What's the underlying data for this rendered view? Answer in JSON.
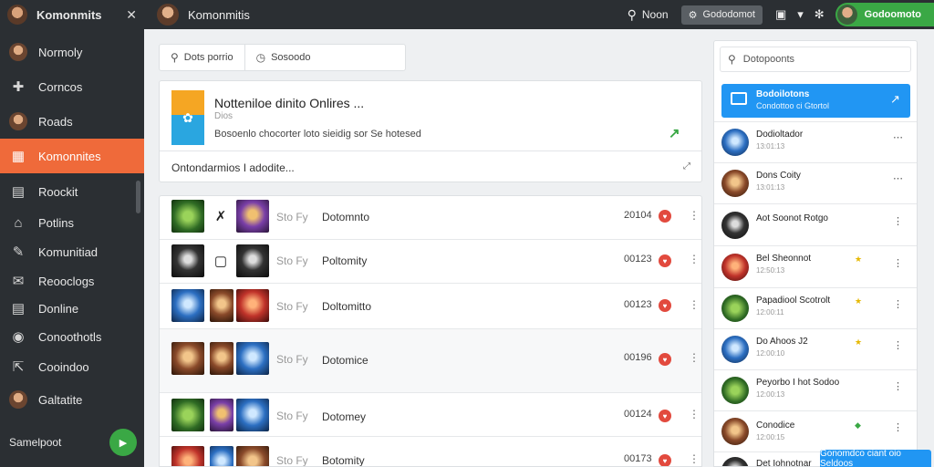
{
  "sidebar": {
    "title": "Komonmits",
    "items": [
      {
        "label": "Normoly",
        "icon": "user-avatar-icon",
        "active": false
      },
      {
        "label": "Corncos",
        "icon": "puzzle-icon",
        "active": false
      },
      {
        "label": "Roads",
        "icon": "user-avatar-icon",
        "active": false
      },
      {
        "label": "Komonnites",
        "icon": "community-icon",
        "active": true
      },
      {
        "label": "Roockit",
        "icon": "calendar-icon",
        "active": false
      },
      {
        "label": "Potlins",
        "icon": "building-icon",
        "active": false
      },
      {
        "label": "Komunitiad",
        "icon": "wrench-icon",
        "active": false
      },
      {
        "label": "Reooclogs",
        "icon": "mail-icon",
        "active": false
      },
      {
        "label": "Donline",
        "icon": "calendar-icon",
        "active": false
      },
      {
        "label": "Conoothotls",
        "icon": "chat-icon",
        "active": false
      },
      {
        "label": "Cooindoo",
        "icon": "share-icon",
        "active": false
      },
      {
        "label": "Galtatite",
        "icon": "user-avatar-icon",
        "active": false
      }
    ],
    "footer_label": "Samelpoot"
  },
  "topbar": {
    "title": "Komonmitis",
    "search_label": "Noon",
    "button_label": "Gododomot",
    "user_label": "Godoomoto"
  },
  "tabs": [
    {
      "label": "Dots porrio",
      "icon": "search-icon"
    },
    {
      "label": "Sosoodo",
      "icon": "clock-icon"
    }
  ],
  "hero": {
    "title": "Notteniloe dinito Onlires ...",
    "subtitle": "Dios",
    "description": "Bosoenlo chocorter loto sieidig sor Se hotesed",
    "input_placeholder": "Ontondarmios I adodite..."
  },
  "list": {
    "rows": [
      {
        "code": "Sto Fy",
        "name": "Dotomnto",
        "count": "20104"
      },
      {
        "code": "Sto Fy",
        "name": "Poltomity",
        "count": "00123"
      },
      {
        "code": "Sto Fy",
        "name": "Doltomitto",
        "count": "00123"
      },
      {
        "code": "Sto Fy",
        "name": "Dotomice",
        "count": "00196"
      },
      {
        "code": "Sto Fy",
        "name": "Dotomey",
        "count": "00124"
      },
      {
        "code": "Sto Fy",
        "name": "Botomity",
        "count": "00173"
      }
    ]
  },
  "rightpanel": {
    "search_placeholder": "Dotopoonts",
    "feature": {
      "title": "Bodoilotons",
      "subtitle": "Condottoo ci Gtortol"
    },
    "items": [
      {
        "name": "Dodioltador",
        "sub": "13:01:13",
        "badge": ""
      },
      {
        "name": "Dons Coity",
        "sub": "13:01:13",
        "badge": ""
      },
      {
        "name": "Aot Soonot Rotgo",
        "sub": "",
        "badge": ""
      },
      {
        "name": "Bel Sheonnot",
        "sub": "12:50:13",
        "badge": "star-yellow"
      },
      {
        "name": "Papadiool Scotrolt",
        "sub": "12:00:11",
        "badge": "star-yellow"
      },
      {
        "name": "Do Ahoos J2",
        "sub": "12:00:10",
        "badge": "star-yellow"
      },
      {
        "name": "Peyorbo I hot Sodoo",
        "sub": "12:00:13",
        "badge": ""
      },
      {
        "name": "Conodice",
        "sub": "12:00:15",
        "badge": "star-green"
      },
      {
        "name": "Det Iohnotnar",
        "sub": "",
        "badge": ""
      }
    ]
  },
  "toast": {
    "label": "Gonomdco ciant oio Seldoos"
  },
  "colors": {
    "accent": "#ef6a3a",
    "primary": "#2196f3",
    "success": "#3aa845",
    "danger": "#e24a3e"
  }
}
